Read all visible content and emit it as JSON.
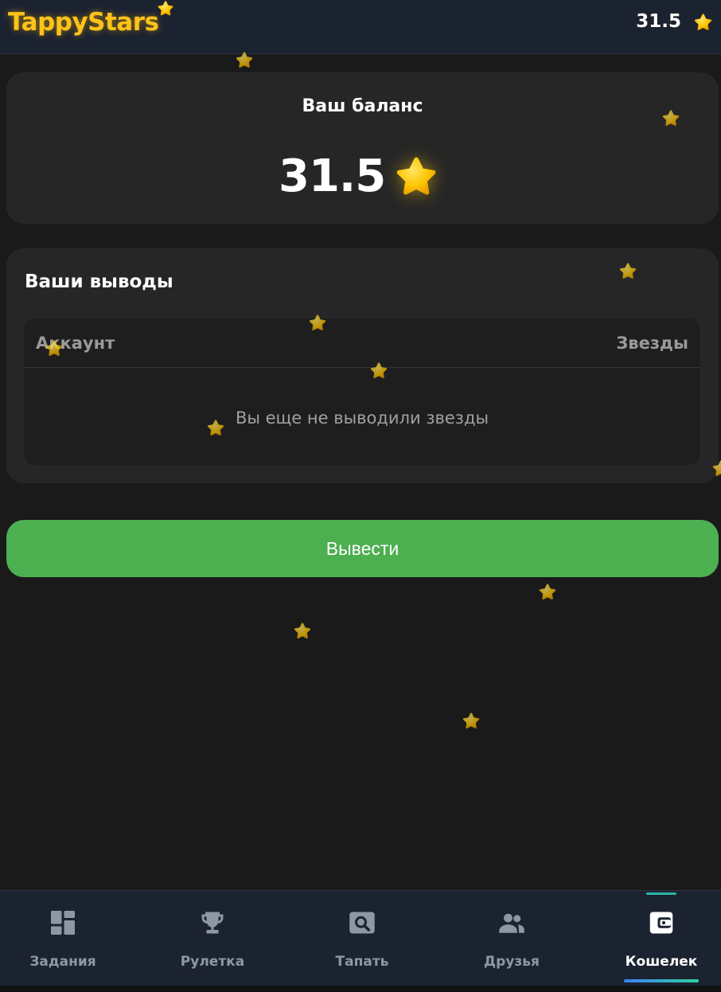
{
  "header": {
    "app_title": "TappyStars",
    "balance": "31.5",
    "balance_icon": "star-icon"
  },
  "balance_card": {
    "title": "Ваш баланс",
    "value": "31.5",
    "icon": "star-icon"
  },
  "withdrawals": {
    "title": "Ваши выводы",
    "columns": [
      "Аккаунт",
      "Звезды"
    ],
    "empty_message": "Вы еще не выводили звезды"
  },
  "withdraw_button": {
    "label": "Вывести"
  },
  "nav": {
    "items": [
      {
        "label": "Задания",
        "icon": "tasks-icon",
        "active": false
      },
      {
        "label": "Рулетка",
        "icon": "trophy-icon",
        "active": false
      },
      {
        "label": "Тапать",
        "icon": "tap-icon",
        "active": false
      },
      {
        "label": "Друзья",
        "icon": "friends-icon",
        "active": false
      },
      {
        "label": "Кошелек",
        "icon": "wallet-icon",
        "active": true
      }
    ]
  },
  "colors": {
    "accent_gold": "#ffc21a",
    "button_green": "#4caf50",
    "background": "#1a1a1a",
    "card": "#262626",
    "header_bg": "#1c2330"
  }
}
